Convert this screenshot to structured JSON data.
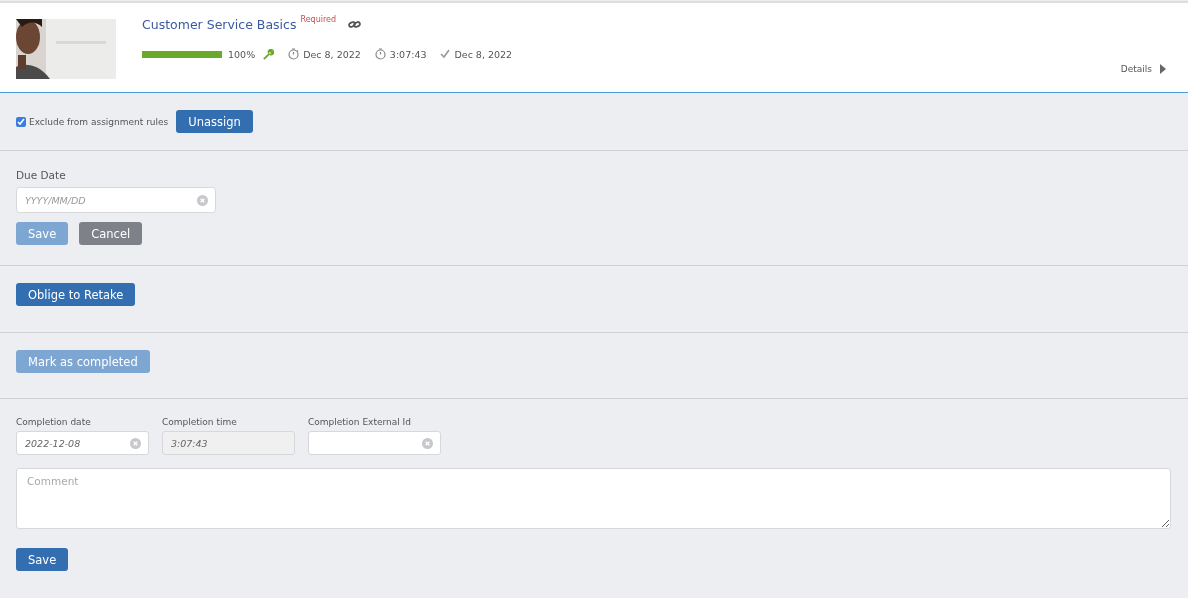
{
  "course": {
    "title": "Customer Service Basics",
    "badge": "Required",
    "progress": {
      "level": 1.0,
      "reading": "100%"
    },
    "started": "Dec 8, 2022",
    "duration": "3:07:43",
    "completed": "Dec 8, 2022",
    "details_link": "Details"
  },
  "assignment": {
    "exclude": {
      "label": "Exclude from assignment rules",
      "checked": true
    },
    "unassign_button": "Unassign"
  },
  "due_date": {
    "label": "Due Date",
    "placeholder": "YYYY/MM/DD",
    "buttons": [
      {
        "label": "Save",
        "kind": "primary",
        "disabled": true
      },
      {
        "label": "Cancel",
        "kind": "secondary"
      }
    ]
  },
  "retake": {
    "button": {
      "label": "Oblige to Retake",
      "disabled": false
    }
  },
  "mark_completed": {
    "button": {
      "label": "Mark as completed",
      "disabled": true
    }
  },
  "completion": {
    "fields": [
      {
        "label": "Completion date",
        "value": "2022-12-08",
        "disabled": false
      },
      {
        "label": "Completion time",
        "value": "3:07:43",
        "disabled": true
      },
      {
        "label": "Completion External Id",
        "disabled": false
      }
    ],
    "comment": {
      "placeholder": "Comment"
    },
    "save_button": {
      "label": "Save",
      "disabled": false
    }
  }
}
